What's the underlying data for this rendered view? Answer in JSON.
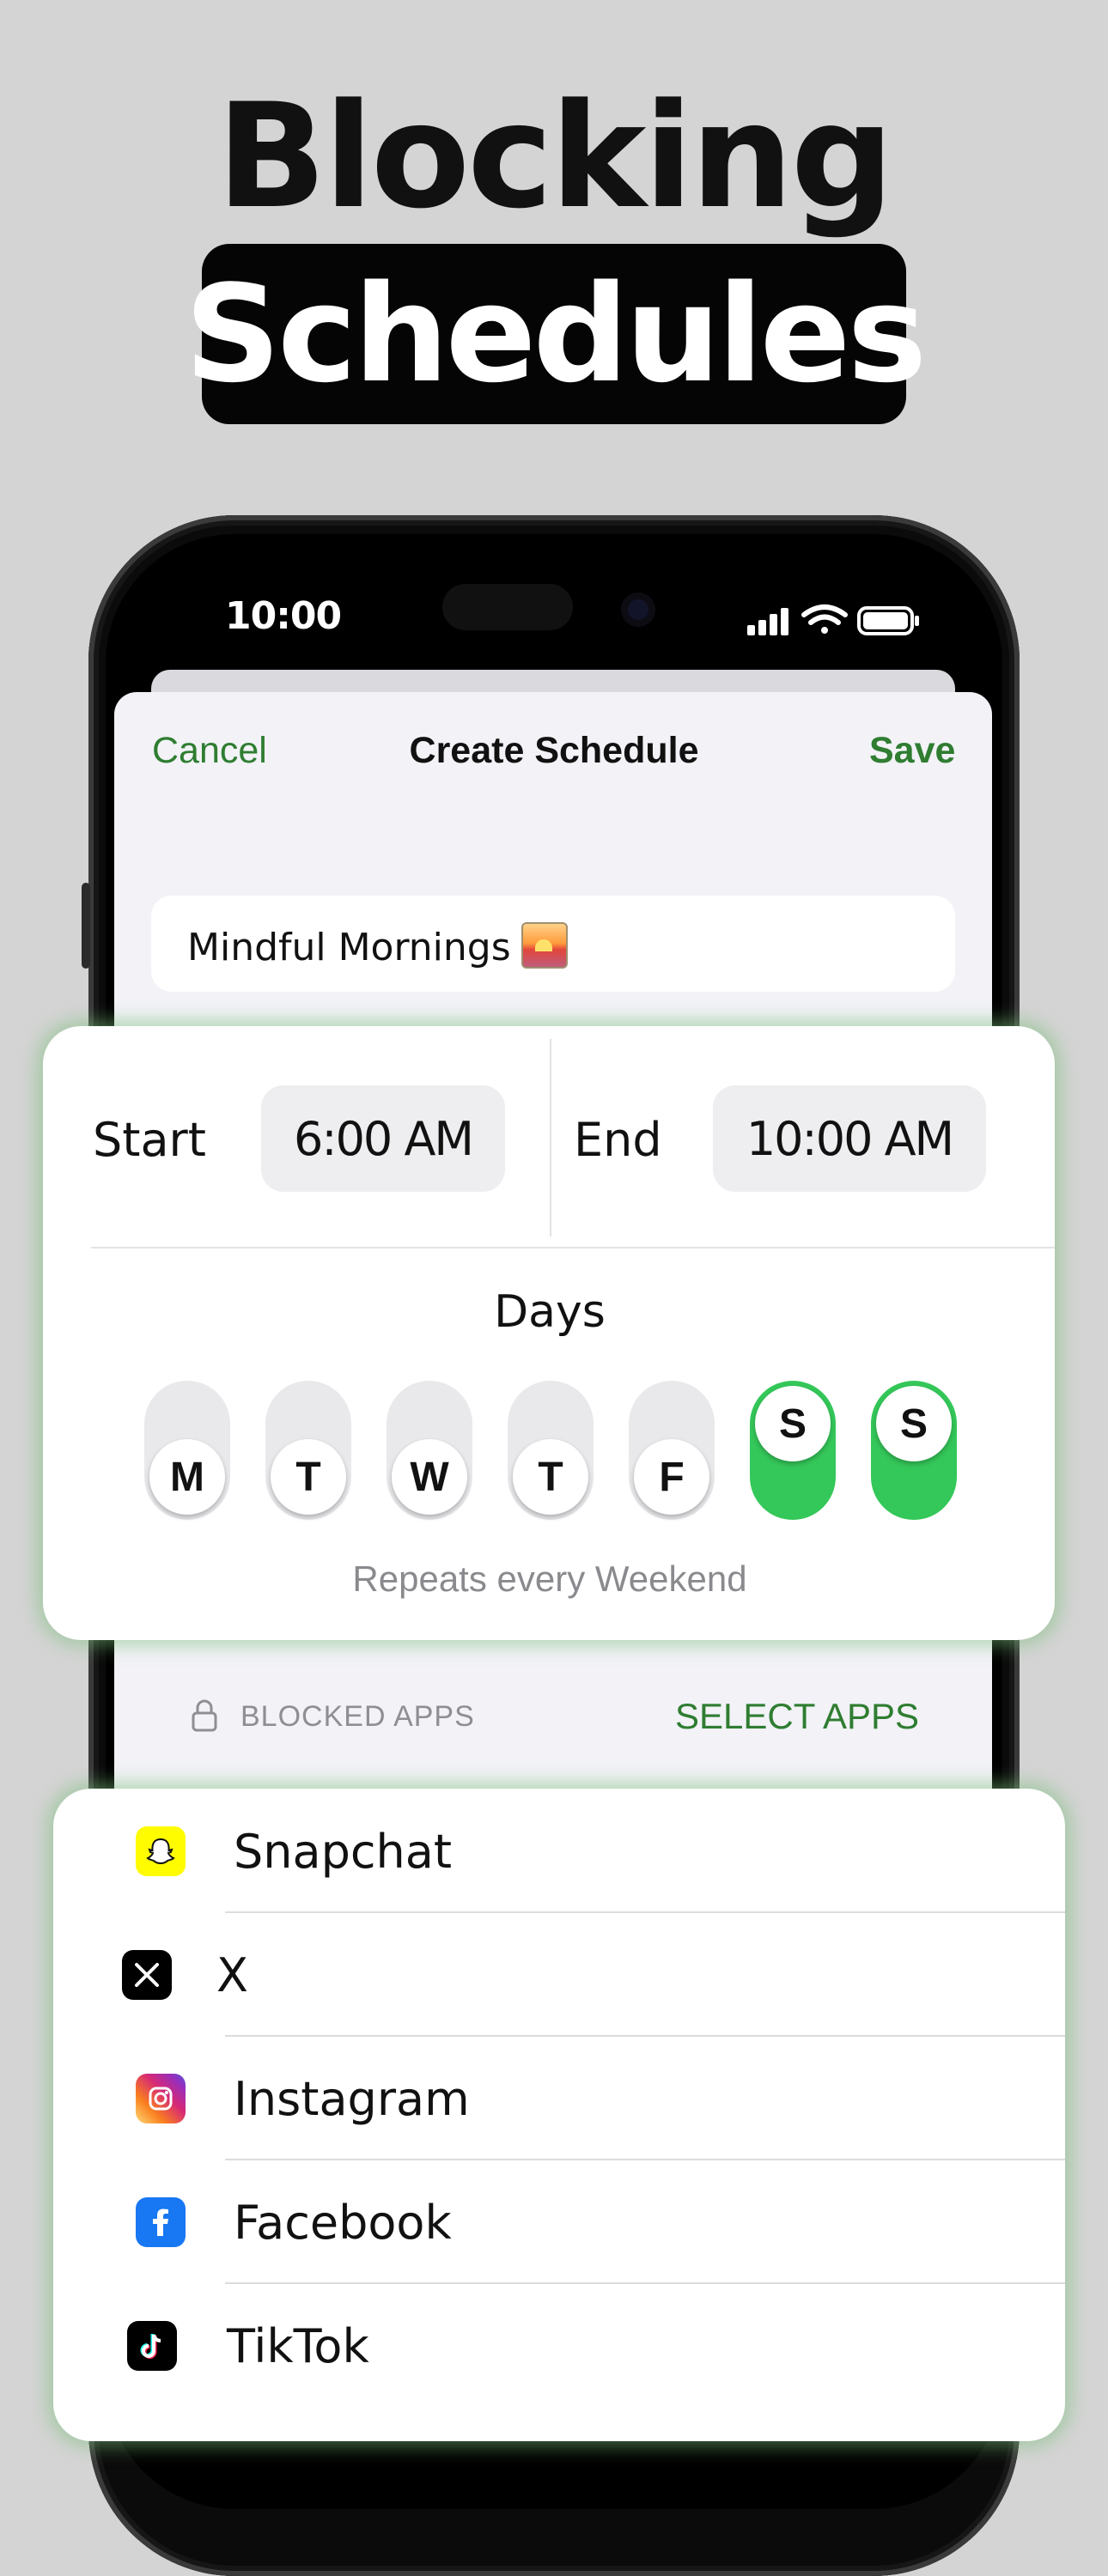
{
  "headline": {
    "line1": "Blocking",
    "line2": "Schedules"
  },
  "status_bar": {
    "time": "10:00",
    "icons": [
      "cellular-signal-icon",
      "wifi-icon",
      "battery-icon"
    ]
  },
  "nav": {
    "cancel": "Cancel",
    "title": "Create Schedule",
    "save": "Save"
  },
  "schedule_name": "Mindful Mornings",
  "schedule_emoji": "sunrise-icon",
  "time": {
    "start_label": "Start",
    "start_value": "6:00 AM",
    "end_label": "End",
    "end_value": "10:00 AM"
  },
  "days": {
    "title": "Days",
    "items": [
      {
        "letter": "M",
        "selected": false
      },
      {
        "letter": "T",
        "selected": false
      },
      {
        "letter": "W",
        "selected": false
      },
      {
        "letter": "T",
        "selected": false
      },
      {
        "letter": "F",
        "selected": false
      },
      {
        "letter": "S",
        "selected": true
      },
      {
        "letter": "S",
        "selected": true
      }
    ],
    "repeats": "Repeats every Weekend"
  },
  "blocked_apps": {
    "label": "BLOCKED APPS",
    "action": "SELECT APPS",
    "apps": [
      {
        "name": "Snapchat",
        "icon": "snapchat-icon"
      },
      {
        "name": "X",
        "icon": "x-icon"
      },
      {
        "name": "Instagram",
        "icon": "instagram-icon"
      },
      {
        "name": "Facebook",
        "icon": "facebook-icon"
      },
      {
        "name": "TikTok",
        "icon": "tiktok-icon"
      }
    ]
  },
  "colors": {
    "accent": "#2f7d31",
    "toggle_on": "#34c759",
    "card_glow": "#8fd08f"
  }
}
